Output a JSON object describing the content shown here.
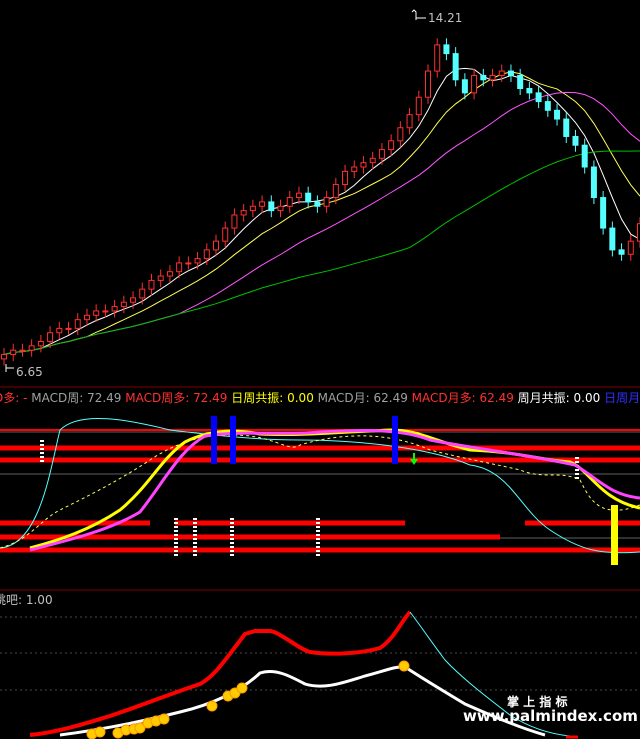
{
  "price_panel": {
    "high_label": "14.21",
    "low_label": "6.65"
  },
  "macd_panel": {
    "legend": [
      {
        "text": "D多: -",
        "color": "#ff3030"
      },
      {
        "text": "MACD周: 72.49",
        "color": "#a0a0a0"
      },
      {
        "text": "MACD周多: 72.49",
        "color": "#ff3030"
      },
      {
        "text": "日周共振: 0.00",
        "color": "#ffff00"
      },
      {
        "text": "MACD月: 62.49",
        "color": "#a0a0a0"
      },
      {
        "text": "MACD月多: 62.49",
        "color": "#ff3030"
      },
      {
        "text": "周月共振: 0.00",
        "color": "#ffffff"
      },
      {
        "text": "日周月共",
        "color": "#3030ff"
      }
    ]
  },
  "bottom_panel": {
    "legend": "跳吧: 1.00"
  },
  "watermark": {
    "top": "掌 上 指 标",
    "bottom": "www.palmindex.com"
  },
  "chart_data": {
    "type": "candlestick",
    "price_labels": {
      "high": 14.21,
      "low": 6.65
    },
    "closes": [
      6.7,
      6.8,
      6.8,
      6.9,
      7.0,
      7.2,
      7.3,
      7.3,
      7.5,
      7.6,
      7.7,
      7.7,
      7.8,
      7.9,
      8.0,
      8.2,
      8.4,
      8.5,
      8.6,
      8.8,
      8.8,
      8.9,
      9.1,
      9.3,
      9.6,
      9.9,
      10.0,
      10.1,
      10.2,
      10.0,
      10.1,
      10.3,
      10.4,
      10.2,
      10.1,
      10.3,
      10.6,
      10.9,
      11.0,
      11.1,
      11.2,
      11.4,
      11.6,
      11.9,
      12.2,
      12.6,
      13.2,
      13.8,
      13.6,
      13.0,
      12.7,
      13.1,
      13.0,
      13.1,
      13.2,
      13.1,
      12.8,
      12.7,
      12.5,
      12.3,
      12.1,
      11.7,
      11.5,
      11.0,
      10.3,
      9.6,
      9.1,
      9.0,
      9.3,
      9.7
    ],
    "colors": {
      "up": "#ff3030",
      "down": "#55ffff",
      "ma_white": "#ffffff",
      "ma_yellow": "#ffff55",
      "ma_magenta": "#ff55ff",
      "ma_green": "#00c000"
    },
    "bottom_series": {
      "red_line": "#ff0000",
      "white_line": "#ffffff",
      "cyan_line": "#55ffff",
      "coin": "#ffcc00"
    }
  }
}
